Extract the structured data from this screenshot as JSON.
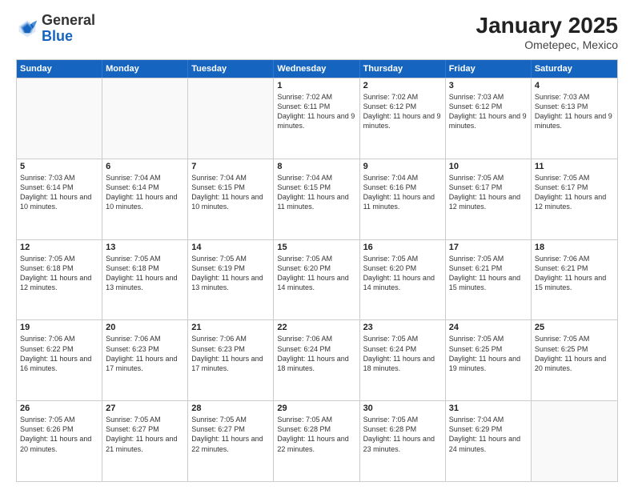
{
  "header": {
    "logo_general": "General",
    "logo_blue": "Blue",
    "title": "January 2025",
    "subtitle": "Ometepec, Mexico"
  },
  "days_of_week": [
    "Sunday",
    "Monday",
    "Tuesday",
    "Wednesday",
    "Thursday",
    "Friday",
    "Saturday"
  ],
  "weeks": [
    [
      {
        "day": "",
        "empty": true
      },
      {
        "day": "",
        "empty": true
      },
      {
        "day": "",
        "empty": true
      },
      {
        "day": "1",
        "sunrise": "7:02 AM",
        "sunset": "6:11 PM",
        "daylight": "11 hours and 9 minutes."
      },
      {
        "day": "2",
        "sunrise": "7:02 AM",
        "sunset": "6:12 PM",
        "daylight": "11 hours and 9 minutes."
      },
      {
        "day": "3",
        "sunrise": "7:03 AM",
        "sunset": "6:12 PM",
        "daylight": "11 hours and 9 minutes."
      },
      {
        "day": "4",
        "sunrise": "7:03 AM",
        "sunset": "6:13 PM",
        "daylight": "11 hours and 9 minutes."
      }
    ],
    [
      {
        "day": "5",
        "sunrise": "7:03 AM",
        "sunset": "6:14 PM",
        "daylight": "11 hours and 10 minutes."
      },
      {
        "day": "6",
        "sunrise": "7:04 AM",
        "sunset": "6:14 PM",
        "daylight": "11 hours and 10 minutes."
      },
      {
        "day": "7",
        "sunrise": "7:04 AM",
        "sunset": "6:15 PM",
        "daylight": "11 hours and 10 minutes."
      },
      {
        "day": "8",
        "sunrise": "7:04 AM",
        "sunset": "6:15 PM",
        "daylight": "11 hours and 11 minutes."
      },
      {
        "day": "9",
        "sunrise": "7:04 AM",
        "sunset": "6:16 PM",
        "daylight": "11 hours and 11 minutes."
      },
      {
        "day": "10",
        "sunrise": "7:05 AM",
        "sunset": "6:17 PM",
        "daylight": "11 hours and 12 minutes."
      },
      {
        "day": "11",
        "sunrise": "7:05 AM",
        "sunset": "6:17 PM",
        "daylight": "11 hours and 12 minutes."
      }
    ],
    [
      {
        "day": "12",
        "sunrise": "7:05 AM",
        "sunset": "6:18 PM",
        "daylight": "11 hours and 12 minutes."
      },
      {
        "day": "13",
        "sunrise": "7:05 AM",
        "sunset": "6:18 PM",
        "daylight": "11 hours and 13 minutes."
      },
      {
        "day": "14",
        "sunrise": "7:05 AM",
        "sunset": "6:19 PM",
        "daylight": "11 hours and 13 minutes."
      },
      {
        "day": "15",
        "sunrise": "7:05 AM",
        "sunset": "6:20 PM",
        "daylight": "11 hours and 14 minutes."
      },
      {
        "day": "16",
        "sunrise": "7:05 AM",
        "sunset": "6:20 PM",
        "daylight": "11 hours and 14 minutes."
      },
      {
        "day": "17",
        "sunrise": "7:05 AM",
        "sunset": "6:21 PM",
        "daylight": "11 hours and 15 minutes."
      },
      {
        "day": "18",
        "sunrise": "7:06 AM",
        "sunset": "6:21 PM",
        "daylight": "11 hours and 15 minutes."
      }
    ],
    [
      {
        "day": "19",
        "sunrise": "7:06 AM",
        "sunset": "6:22 PM",
        "daylight": "11 hours and 16 minutes."
      },
      {
        "day": "20",
        "sunrise": "7:06 AM",
        "sunset": "6:23 PM",
        "daylight": "11 hours and 17 minutes."
      },
      {
        "day": "21",
        "sunrise": "7:06 AM",
        "sunset": "6:23 PM",
        "daylight": "11 hours and 17 minutes."
      },
      {
        "day": "22",
        "sunrise": "7:06 AM",
        "sunset": "6:24 PM",
        "daylight": "11 hours and 18 minutes."
      },
      {
        "day": "23",
        "sunrise": "7:05 AM",
        "sunset": "6:24 PM",
        "daylight": "11 hours and 18 minutes."
      },
      {
        "day": "24",
        "sunrise": "7:05 AM",
        "sunset": "6:25 PM",
        "daylight": "11 hours and 19 minutes."
      },
      {
        "day": "25",
        "sunrise": "7:05 AM",
        "sunset": "6:25 PM",
        "daylight": "11 hours and 20 minutes."
      }
    ],
    [
      {
        "day": "26",
        "sunrise": "7:05 AM",
        "sunset": "6:26 PM",
        "daylight": "11 hours and 20 minutes."
      },
      {
        "day": "27",
        "sunrise": "7:05 AM",
        "sunset": "6:27 PM",
        "daylight": "11 hours and 21 minutes."
      },
      {
        "day": "28",
        "sunrise": "7:05 AM",
        "sunset": "6:27 PM",
        "daylight": "11 hours and 22 minutes."
      },
      {
        "day": "29",
        "sunrise": "7:05 AM",
        "sunset": "6:28 PM",
        "daylight": "11 hours and 22 minutes."
      },
      {
        "day": "30",
        "sunrise": "7:05 AM",
        "sunset": "6:28 PM",
        "daylight": "11 hours and 23 minutes."
      },
      {
        "day": "31",
        "sunrise": "7:04 AM",
        "sunset": "6:29 PM",
        "daylight": "11 hours and 24 minutes."
      },
      {
        "day": "",
        "empty": true
      }
    ]
  ],
  "labels": {
    "sunrise_prefix": "Sunrise: ",
    "sunset_prefix": "Sunset: ",
    "daylight_label": "Daylight: "
  }
}
